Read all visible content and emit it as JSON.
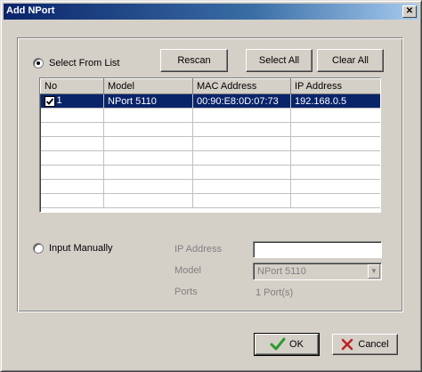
{
  "window": {
    "title": "Add NPort",
    "close_glyph": "✕"
  },
  "select_from_list": {
    "label": "Select From List",
    "checked": true
  },
  "buttons": {
    "rescan": "Rescan",
    "select_all": "Select All",
    "clear_all": "Clear All",
    "ok": "OK",
    "cancel": "Cancel"
  },
  "table": {
    "columns": [
      "No",
      "Model",
      "MAC Address",
      "IP Address"
    ],
    "rows": [
      {
        "no": "1",
        "checked": true,
        "model": "NPort 5110",
        "mac": "00:90:E8:0D:07:73",
        "ip": "192.168.0.5",
        "selected": true
      }
    ]
  },
  "input_manually": {
    "label": "Input Manually",
    "checked": false,
    "ip_label": "IP Address",
    "ip_value": "",
    "model_label": "Model",
    "model_value": "NPort 5110",
    "ports_label": "Ports",
    "ports_value": "1 Port(s)"
  },
  "icons": {
    "ok": "checkmark-icon",
    "cancel": "x-mark-icon"
  },
  "colors": {
    "selection": "#0a246a",
    "ok_check": "#2e9a2e",
    "cancel_x": "#c02020"
  }
}
